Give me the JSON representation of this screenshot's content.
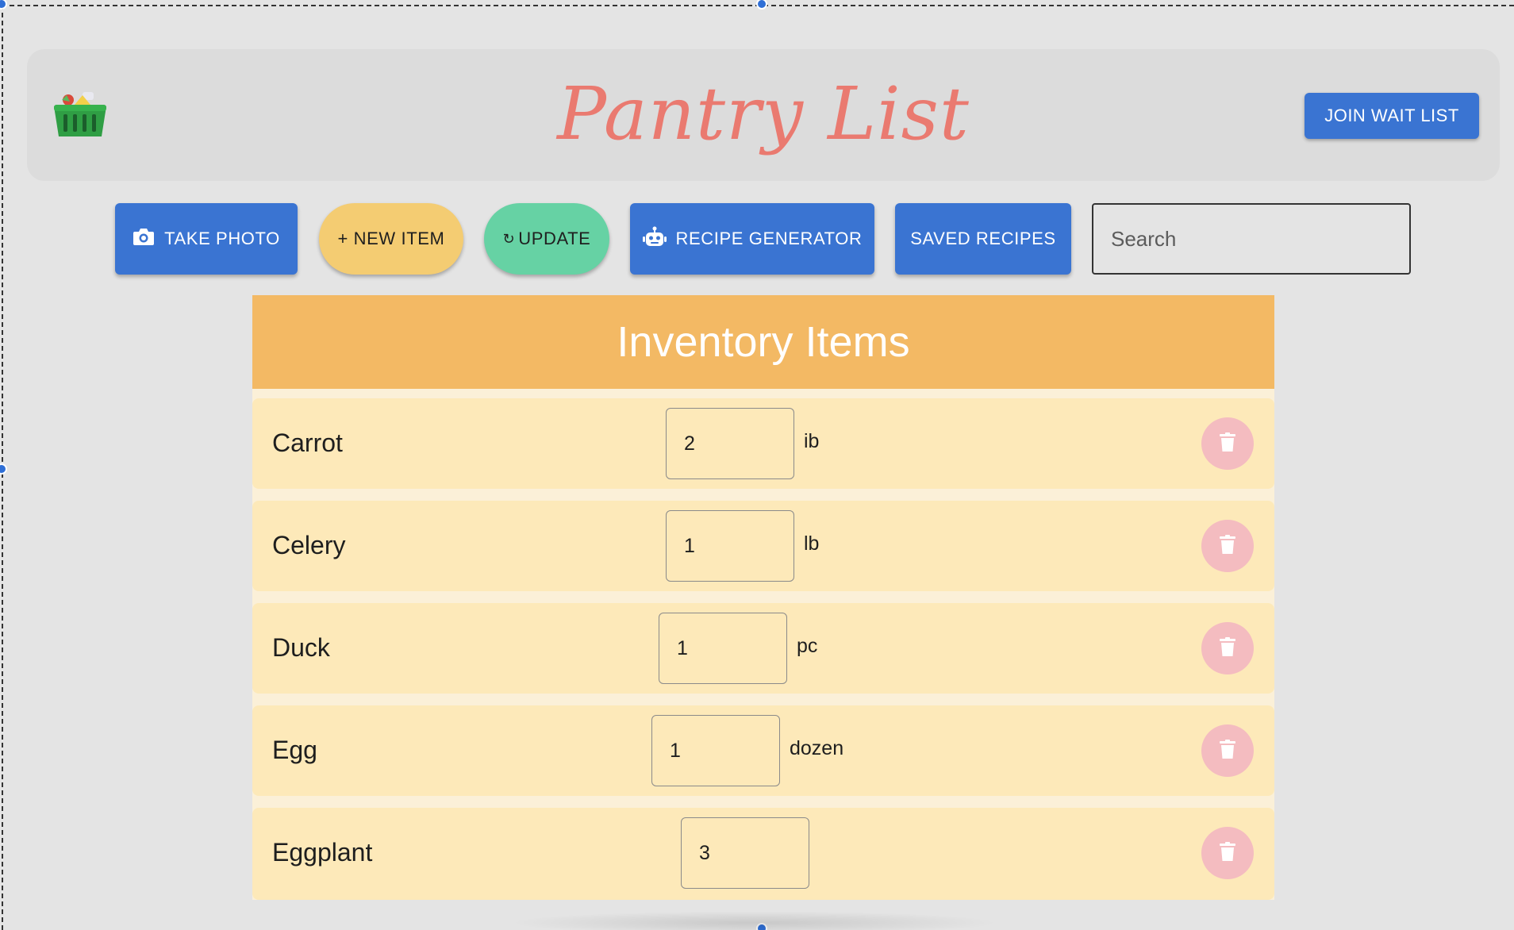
{
  "header": {
    "title": "Pantry List",
    "join_label": "JOIN WAIT LIST",
    "logo_icon": "basket-icon"
  },
  "toolbar": {
    "take_photo": "TAKE PHOTO",
    "new_item": "+ NEW ITEM",
    "update": "UPDATE",
    "update_glyph": "↻",
    "recipe_generator": "RECIPE GENERATOR",
    "saved_recipes": "SAVED RECIPES",
    "search_placeholder": "Search"
  },
  "inventory": {
    "title": "Inventory Items",
    "items": [
      {
        "name": "Carrot",
        "quantity": "2",
        "unit": "ib"
      },
      {
        "name": "Celery",
        "quantity": "1",
        "unit": "lb"
      },
      {
        "name": "Duck",
        "quantity": "1",
        "unit": "pc"
      },
      {
        "name": "Egg",
        "quantity": "1",
        "unit": "dozen"
      },
      {
        "name": "Eggplant",
        "quantity": "3",
        "unit": ""
      }
    ]
  },
  "colors": {
    "primary_blue": "#3a74d2",
    "title_coral": "#ea7a70",
    "inventory_header": "#f3b964",
    "row_bg": "#fde9b9",
    "delete_pink": "#f4bcc0",
    "new_item_yellow": "#f4cc72",
    "update_green": "#66d2a4"
  }
}
